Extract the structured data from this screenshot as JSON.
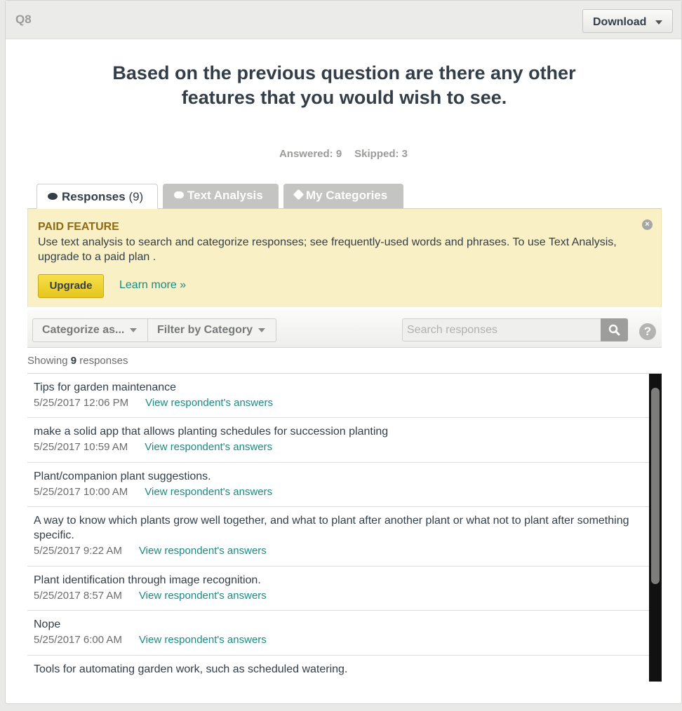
{
  "header": {
    "question_number": "Q8",
    "download_label": "Download"
  },
  "question": {
    "title": "Based on the previous question are there any other features that you would wish to see.",
    "answered": "Answered: 9",
    "skipped": "Skipped: 3"
  },
  "tabs": [
    {
      "label": "Responses",
      "count": "(9)"
    },
    {
      "label": "Text Analysis"
    },
    {
      "label": "My Categories"
    }
  ],
  "paid_feature": {
    "title": "PAID FEATURE",
    "text": "Use text analysis to search and categorize responses; see frequently-used words and phrases. To use Text Analysis, upgrade to a paid plan .",
    "close_glyph": "×",
    "upgrade_label": "Upgrade",
    "learn_more_label": "Learn more »"
  },
  "toolbar": {
    "categorize_label": "Categorize as...",
    "filter_label": "Filter by Category",
    "search_placeholder": "Search responses",
    "help_glyph": "?"
  },
  "showing": {
    "prefix": "Showing",
    "count": "9",
    "suffix": "responses"
  },
  "responses": [
    {
      "text": "Tips for garden maintenance",
      "date": "5/25/2017 12:06 PM",
      "link": "View respondent's answers"
    },
    {
      "text": "make a solid app that allows planting schedules for succession planting",
      "date": "5/25/2017 10:59 AM",
      "link": "View respondent's answers"
    },
    {
      "text": "Plant/companion plant suggestions.",
      "date": "5/25/2017 10:00 AM",
      "link": "View respondent's answers"
    },
    {
      "text": "A way to know which plants grow well together, and what to plant after another plant or what not to plant after something specific.",
      "date": "5/25/2017 9:22 AM",
      "link": "View respondent's answers"
    },
    {
      "text": "Plant identification through image recognition.",
      "date": "5/25/2017 8:57 AM",
      "link": "View respondent's answers"
    },
    {
      "text": "Nope",
      "date": "5/25/2017 6:00 AM",
      "link": "View respondent's answers"
    },
    {
      "text": "Tools for automating garden work, such as scheduled watering.",
      "date": "",
      "link": ""
    }
  ]
}
